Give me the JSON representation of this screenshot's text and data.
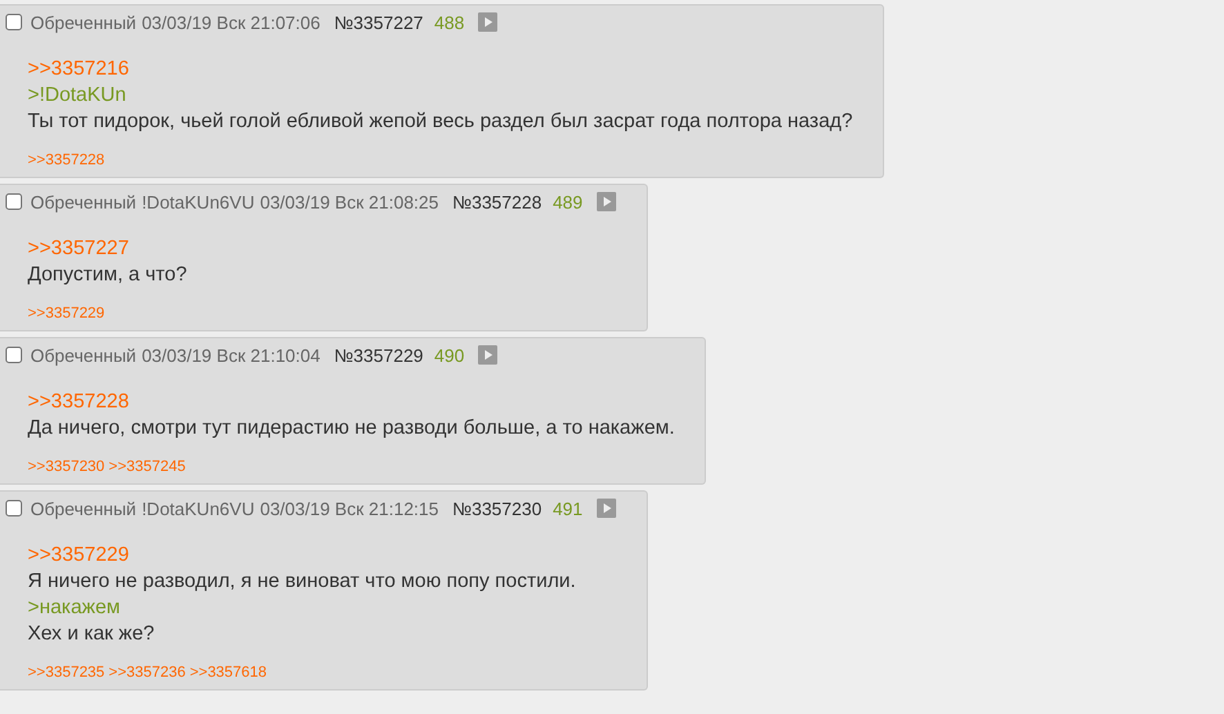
{
  "posts": [
    {
      "selected": false,
      "name": "Обреченный",
      "date": "03/03/19 Вск 21:07:06",
      "number": "№3357227",
      "count": "488",
      "lines": [
        {
          "kind": "reply",
          "text": ">>3357216"
        },
        {
          "kind": "quote",
          "text": ">!DotaKUn"
        },
        {
          "kind": "text",
          "text": "Ты тот пидорок, чьей голой ебливой жепой весь раздел был засрат года полтора назад?"
        }
      ],
      "replies": [
        ">>3357228"
      ]
    },
    {
      "selected": false,
      "name": "Обреченный",
      "trip": "!DotaKUn6VU",
      "date": "03/03/19 Вск 21:08:25",
      "number": "№3357228",
      "count": "489",
      "lines": [
        {
          "kind": "reply",
          "text": ">>3357227"
        },
        {
          "kind": "text",
          "text": "Допустим, а что?"
        }
      ],
      "replies": [
        ">>3357229"
      ]
    },
    {
      "selected": false,
      "name": "Обреченный",
      "date": "03/03/19 Вск 21:10:04",
      "number": "№3357229",
      "count": "490",
      "lines": [
        {
          "kind": "reply",
          "text": ">>3357228"
        },
        {
          "kind": "text",
          "text": "Да ничего, смотри тут пидерастию не разводи больше, а то накажем."
        }
      ],
      "replies": [
        ">>3357230",
        ">>3357245"
      ]
    },
    {
      "selected": false,
      "name": "Обреченный",
      "trip": "!DotaKUn6VU",
      "date": "03/03/19 Вск 21:12:15",
      "number": "№3357230",
      "count": "491",
      "lines": [
        {
          "kind": "reply",
          "text": ">>3357229"
        },
        {
          "kind": "text",
          "text": "Я ничего не разводил, я не виноват что мою попу постили."
        },
        {
          "kind": "quote",
          "text": ">накажем"
        },
        {
          "kind": "text",
          "text": "Хех и как же?"
        }
      ],
      "replies": [
        ">>3357235",
        ">>3357236",
        ">>3357618"
      ]
    }
  ]
}
